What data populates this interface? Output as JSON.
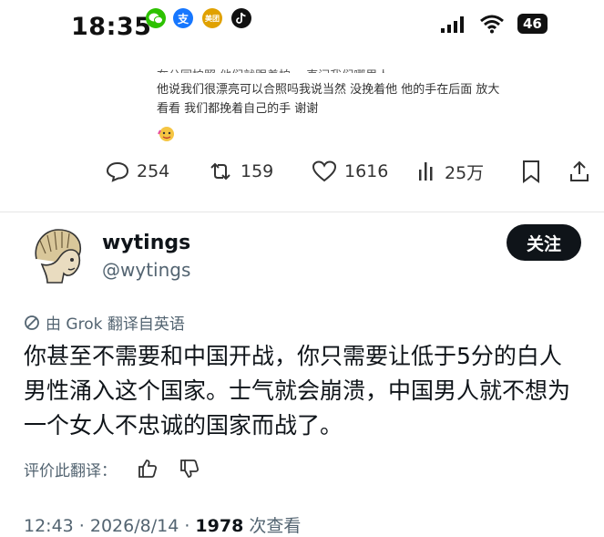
{
  "status_bar": {
    "time": "18:35",
    "app_icons": [
      "wechat-icon",
      "alipay-icon",
      "meituan-icon",
      "tiktok-icon"
    ],
    "app_labels": {
      "alipay": "支",
      "meituan": "美团"
    },
    "system_icons": [
      "signal-icon",
      "wifi-icon"
    ],
    "network": "46"
  },
  "quoted_reply": {
    "cut_line": "在公园拍照 他们就跟着拍 一直问我们哪里人",
    "text": "他说我们很漂亮可以合照吗我说当然 没挽着他 他的手在后面 放大看看 我们都挽着自己的手 谢谢",
    "emoji": "sweat-smile-emoji"
  },
  "actions": {
    "replies": "254",
    "reposts": "159",
    "likes": "1616",
    "views": "25万"
  },
  "post": {
    "display_name": "wytings",
    "handle": "@wytings",
    "follow_label": "关注",
    "translated_label": "由 Grok 翻译自英语",
    "text": "你甚至不需要和中国开战，你只需要让低于5分的白人男性涌入这个国家。士气就会崩溃，中国男人就不想为一个女人不忠诚的国家而战了。",
    "rate_label": "评价此翻译：",
    "timestamp": "12:43 · 2026/8/14 · ",
    "view_count": "1978",
    "views_suffix": " 次查看"
  }
}
